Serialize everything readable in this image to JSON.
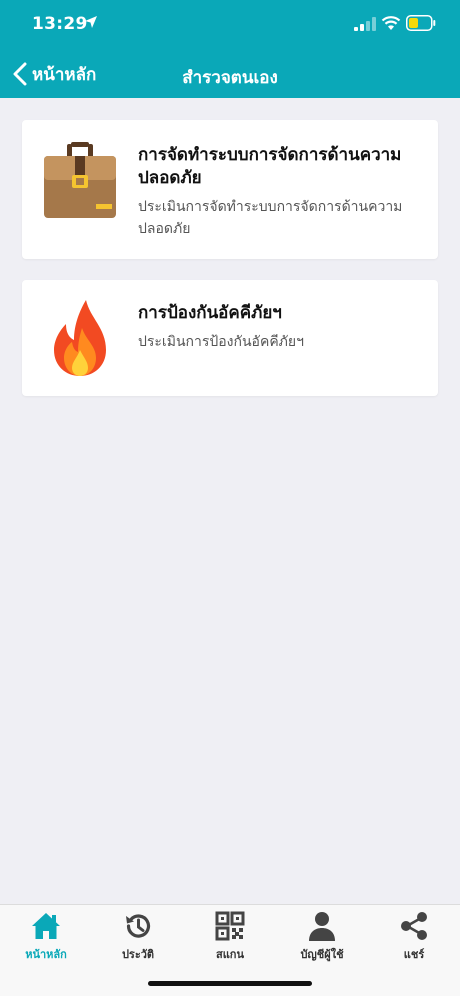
{
  "status_bar": {
    "time": "13:29"
  },
  "nav": {
    "back_label": "หน้าหลัก",
    "title": "สำรวจตนเอง"
  },
  "cards": [
    {
      "icon": "briefcase-icon",
      "title": "การจัดทำระบบการจัดการด้านความปลอดภัย",
      "description": "ประเมินการจัดทำระบบการจัดการด้านความปลอดภัย"
    },
    {
      "icon": "fire-icon",
      "title": "การป้องกันอัคคีภัยฯ",
      "description": "ประเมินการป้องกันอัคคีภัยฯ"
    }
  ],
  "tabs": [
    {
      "label": "หน้าหลัก",
      "icon": "home-icon",
      "active": true
    },
    {
      "label": "ประวัติ",
      "icon": "history-icon",
      "active": false
    },
    {
      "label": "สแกน",
      "icon": "qr-code-icon",
      "active": false
    },
    {
      "label": "บัญชีผู้ใช้",
      "icon": "user-icon",
      "active": false
    },
    {
      "label": "แชร์",
      "icon": "share-icon",
      "active": false
    }
  ],
  "colors": {
    "header": "#0aa8b8",
    "background": "#efeff4",
    "active_tab": "#0aa8b8",
    "inactive_icon": "#444444"
  }
}
